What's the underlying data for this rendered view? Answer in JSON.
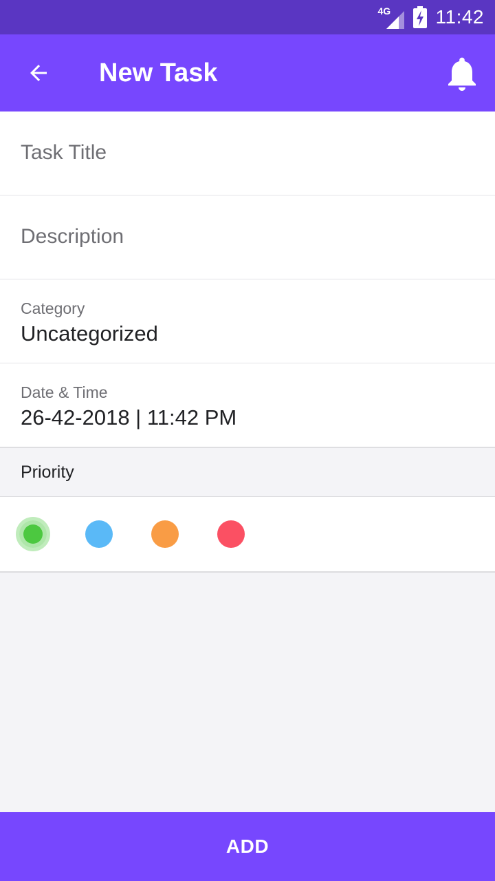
{
  "status_bar": {
    "network": "4G",
    "time": "11:42",
    "icons": [
      "signal-icon",
      "battery-charging-icon"
    ]
  },
  "app_bar": {
    "title": "New Task",
    "back_icon": "arrow-left-icon",
    "action_icon": "bell-icon"
  },
  "form": {
    "title_placeholder": "Task Title",
    "description_placeholder": "Description",
    "category_label": "Category",
    "category_value": "Uncategorized",
    "datetime_label": "Date & Time",
    "datetime_value": "26-42-2018 | 11:42 PM"
  },
  "priority": {
    "label": "Priority",
    "options": [
      {
        "color": "#4cc840",
        "selected": true
      },
      {
        "color": "#5ab9f7",
        "selected": false
      },
      {
        "color": "#f99c45",
        "selected": false
      },
      {
        "color": "#fb5063",
        "selected": false
      }
    ]
  },
  "add_button_label": "ADD",
  "colors": {
    "status_bar": "#5a36c2",
    "primary": "#7747fe",
    "background": "#f4f4f7"
  }
}
